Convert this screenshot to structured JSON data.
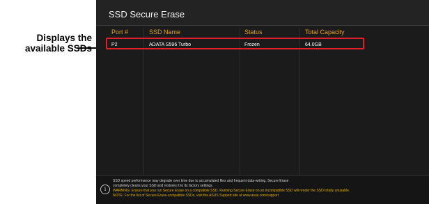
{
  "callout": {
    "line1": "Displays the",
    "line2": "available SSDs"
  },
  "window": {
    "title": "SSD Secure Erase"
  },
  "table": {
    "headers": [
      "Port #",
      "SSD Name",
      "Status",
      "Total Capacity"
    ],
    "rows": [
      [
        "P2",
        "ADATA S596 Turbo",
        "Frozen",
        "64.0GB"
      ]
    ]
  },
  "footer": {
    "info_icon": "info-icon",
    "line1": "SSD speed performance may degrade over time due to accumulated files and frequent data-writing. Secure Erase",
    "line2": "completely cleans your SSD and restores it to its factory settings.",
    "line3": "WARNING: Ensure that you run Secure Erase on a compatible SSD. Running Secure Erase on an incompatible SSD will render the SSD totally unusable.",
    "line4": "NOTE: For the list of Secure Erase-compatible SSDs, visit the ASUS Support site at www.asus.com/support"
  },
  "colors": {
    "header_text": "#e0a020",
    "highlight_border": "#e0202a",
    "panel_bg": "#1b1b1b",
    "warning_text": "#e0b000"
  }
}
